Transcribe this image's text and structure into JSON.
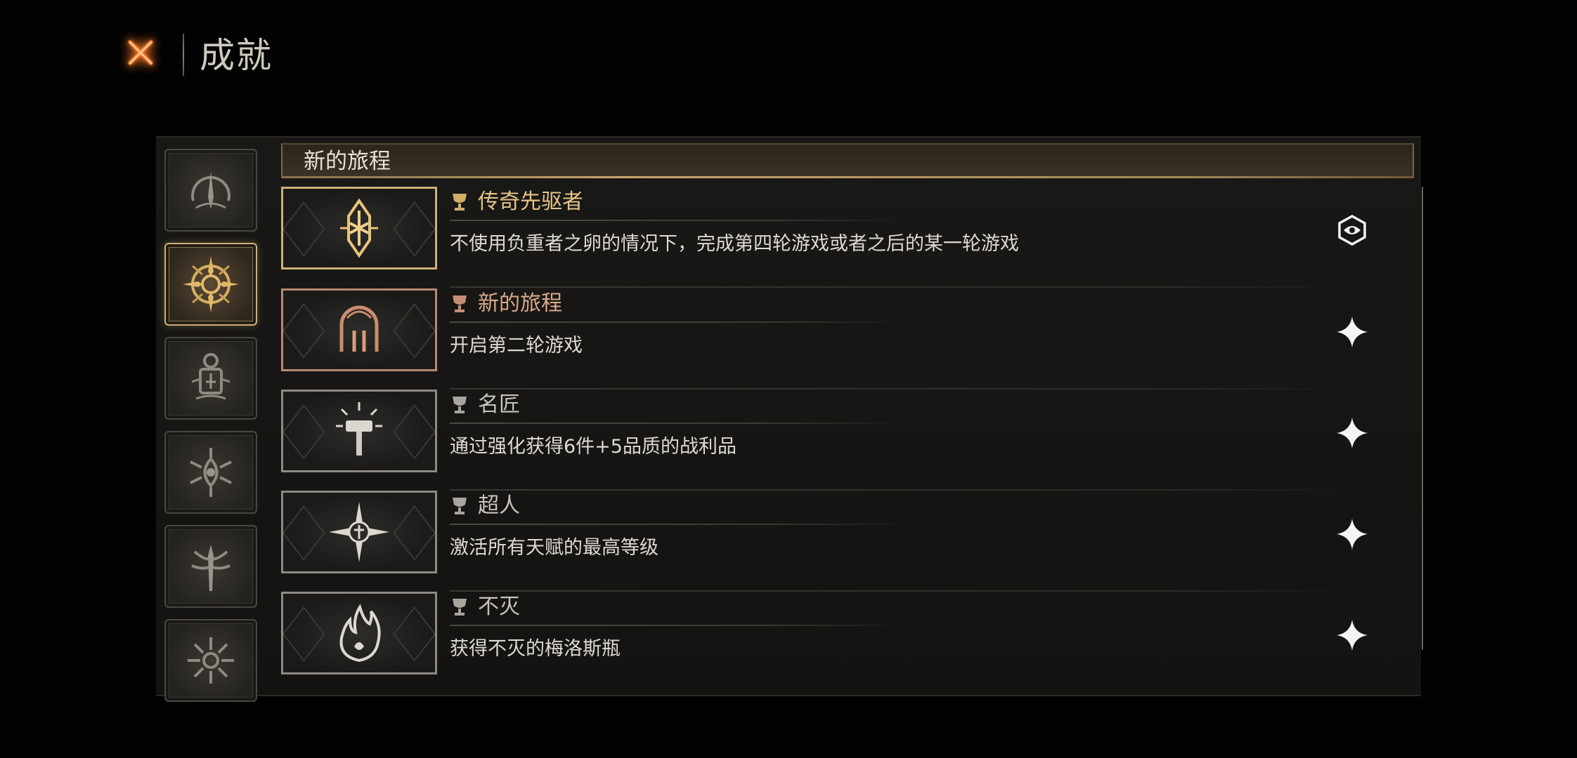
{
  "header": {
    "title": "成就",
    "close_icon": "close-x-icon",
    "accent_color": "#ff7a2a"
  },
  "sidebar": {
    "tabs": [
      {
        "icon": "arch-sigil-icon",
        "active": false
      },
      {
        "icon": "sun-compass-sigil-icon",
        "active": true
      },
      {
        "icon": "lantern-sigil-icon",
        "active": false
      },
      {
        "icon": "eye-thorn-sigil-icon",
        "active": false
      },
      {
        "icon": "blade-tree-sigil-icon",
        "active": false
      },
      {
        "icon": "thorn-star-sigil-icon",
        "active": false
      }
    ]
  },
  "section": {
    "title": "新的旅程"
  },
  "achievements": [
    {
      "title": "传奇先驱者",
      "description": "不使用负重者之卵的情况下，完成第四轮游戏或者之后的某一轮游戏",
      "tier": "gold",
      "emblem": "rune-emblem-icon",
      "status_icon": "eye-glyph-icon"
    },
    {
      "title": "新的旅程",
      "description": "开启第二轮游戏",
      "tier": "bronze",
      "emblem": "gate-emblem-icon",
      "status_icon": "sparkle-icon"
    },
    {
      "title": "名匠",
      "description": "通过强化获得6件+5品质的战利品",
      "tier": "silver",
      "emblem": "hammer-emblem-icon",
      "status_icon": "sparkle-icon"
    },
    {
      "title": "超人",
      "description": "激活所有天赋的最高等级",
      "tier": "silver",
      "emblem": "star-shield-emblem-icon",
      "status_icon": "sparkle-icon"
    },
    {
      "title": "不灭",
      "description": "获得不灭的梅洛斯瓶",
      "tier": "silver",
      "emblem": "flame-emblem-icon",
      "status_icon": "sparkle-icon"
    }
  ]
}
